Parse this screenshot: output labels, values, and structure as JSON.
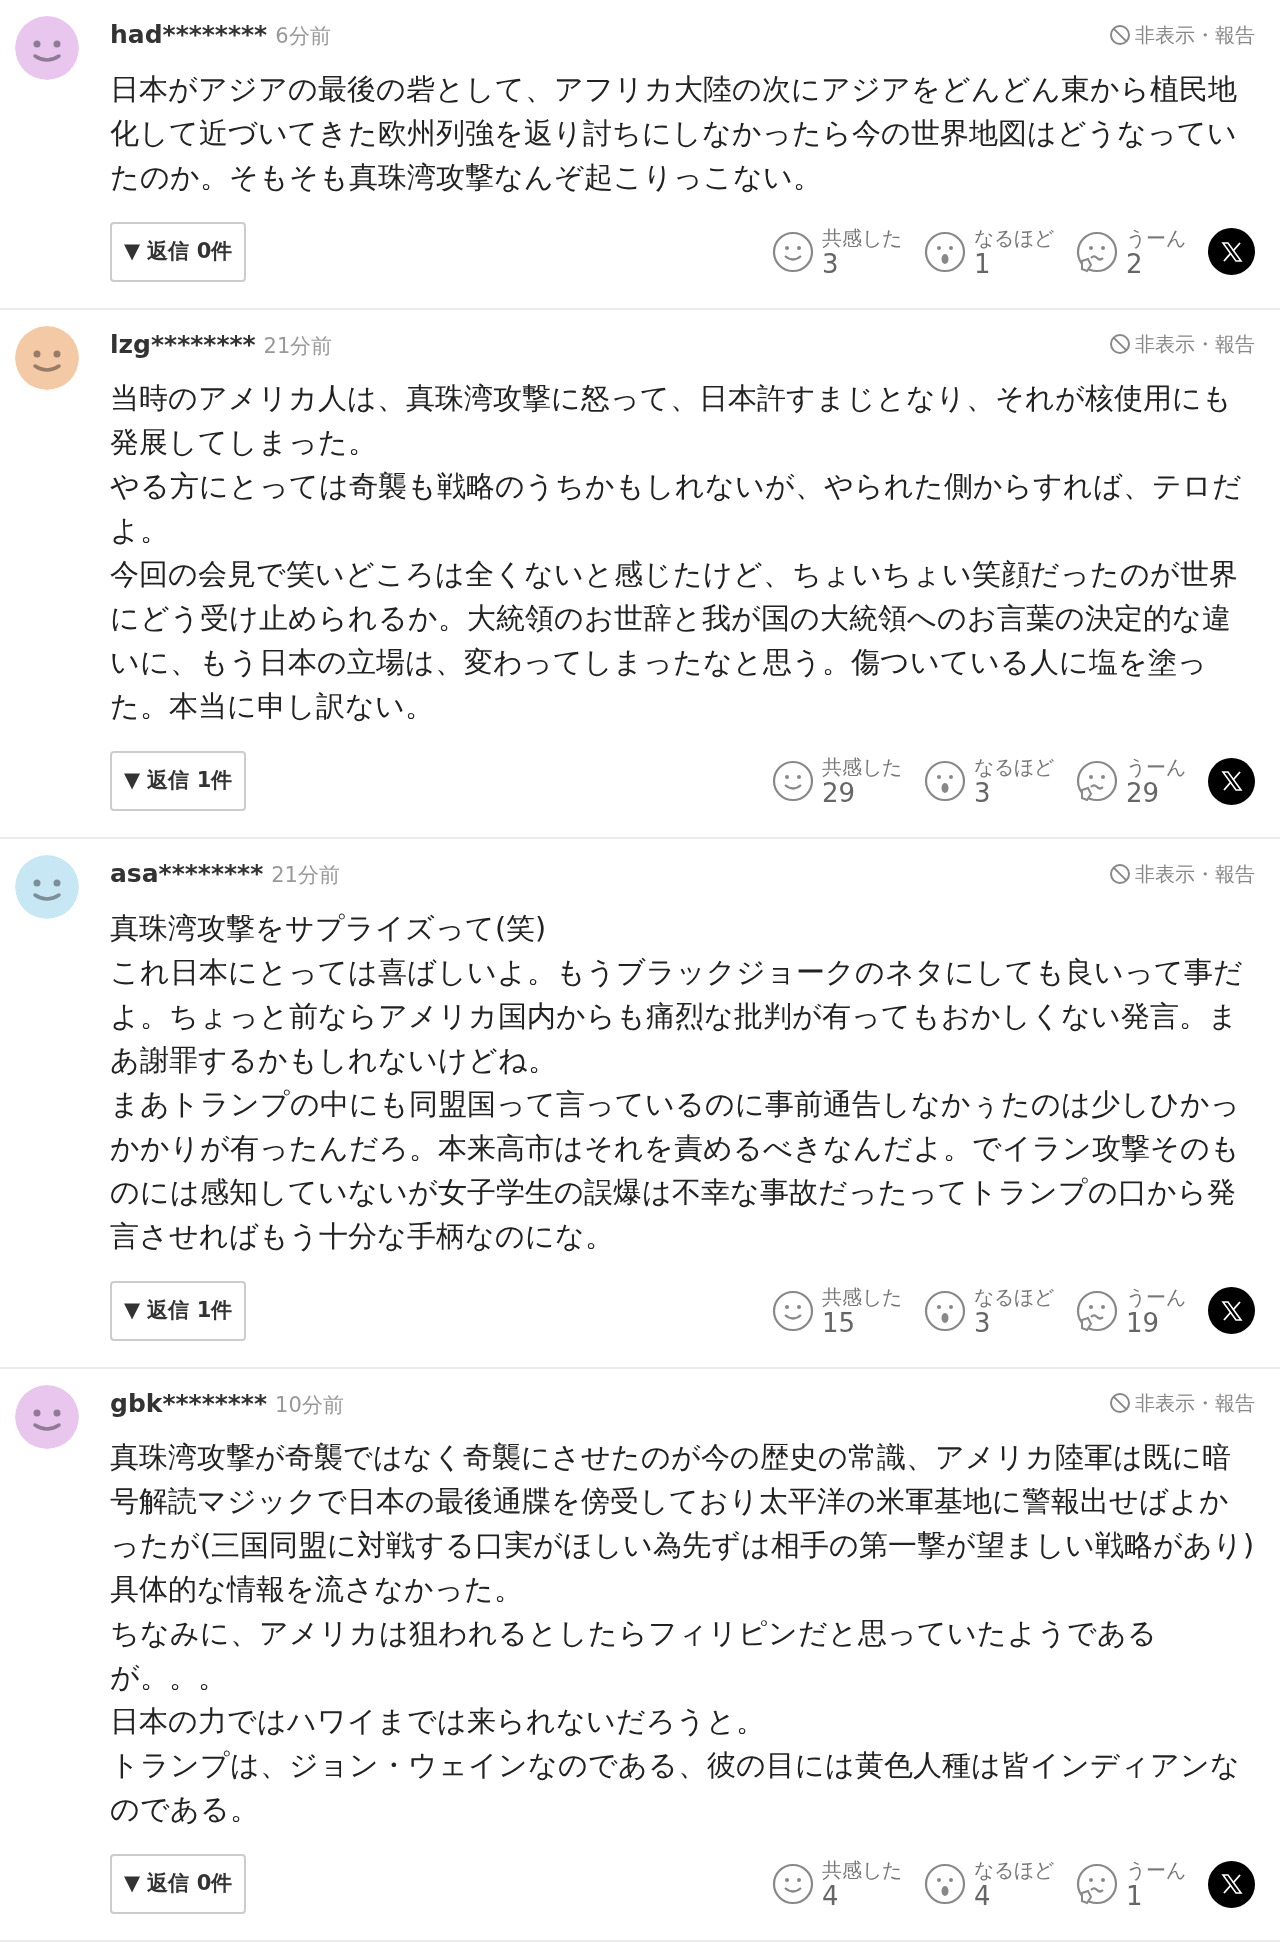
{
  "comments": [
    {
      "color": "#e8c6ee",
      "user": "had********",
      "time": "6分前",
      "hide_report": "非表示・報告",
      "body": [
        "日本がアジアの最後の砦として、アフリカ大陸の次にアジアをどんどん東から植民地化して近づいてきた欧州列強を返り討ちにしなかったら今の世界地図はどうなっていたのか。そもそも真珠湾攻撃なんぞ起こりっこない。"
      ],
      "reply_button": "▼ 返信 0件",
      "reactions": [
        {
          "kind": "smile",
          "label": "共感した",
          "count": "3"
        },
        {
          "kind": "surprised",
          "label": "なるほど",
          "count": "1"
        },
        {
          "kind": "hmm",
          "label": "うーん",
          "count": "2"
        }
      ]
    },
    {
      "color": "#f4c9a6",
      "user": "lzg********",
      "time": "21分前",
      "hide_report": "非表示・報告",
      "body": [
        "当時のアメリカ人は、真珠湾攻撃に怒って、日本許すまじとなり、それが核使用にも発展してしまった。",
        "やる方にとっては奇襲も戦略のうちかもしれないが、やられた側からすれば、テロだよ。",
        "今回の会見で笑いどころは全くないと感じたけど、ちょいちょい笑顔だったのが世界にどう受け止められるか。大統領のお世辞と我が国の大統領へのお言葉の決定的な違いに、もう日本の立場は、変わってしまったなと思う。傷ついている人に塩を塗った。本当に申し訳ない。"
      ],
      "reply_button": "▼ 返信 1件",
      "reactions": [
        {
          "kind": "smile",
          "label": "共感した",
          "count": "29"
        },
        {
          "kind": "surprised",
          "label": "なるほど",
          "count": "3"
        },
        {
          "kind": "hmm",
          "label": "うーん",
          "count": "29"
        }
      ]
    },
    {
      "color": "#c8e7f5",
      "user": "asa********",
      "time": "21分前",
      "hide_report": "非表示・報告",
      "body": [
        "真珠湾攻撃をサプライズって(笑)",
        "これ日本にとっては喜ばしいよ。もうブラックジョークのネタにしても良いって事だよ。ちょっと前ならアメリカ国内からも痛烈な批判が有ってもおかしくない発言。まあ謝罪するかもしれないけどね。",
        "まあトランプの中にも同盟国って言っているのに事前通告しなかぅたのは少しひかっかかりが有ったんだろ。本来高市はそれを責めるべきなんだよ。でイラン攻撃そのものには感知していないが女子学生の誤爆は不幸な事故だったってトランプの口から発言させればもう十分な手柄なのにな。"
      ],
      "reply_button": "▼ 返信 1件",
      "reactions": [
        {
          "kind": "smile",
          "label": "共感した",
          "count": "15"
        },
        {
          "kind": "surprised",
          "label": "なるほど",
          "count": "3"
        },
        {
          "kind": "hmm",
          "label": "うーん",
          "count": "19"
        }
      ]
    },
    {
      "color": "#e8c6ee",
      "user": "gbk********",
      "time": "10分前",
      "hide_report": "非表示・報告",
      "body": [
        "真珠湾攻撃が奇襲ではなく奇襲にさせたのが今の歴史の常識、アメリカ陸軍は既に暗号解読マジックで日本の最後通牒を傍受しており太平洋の米軍基地に警報出せばよかったが(三国同盟に対戦する口実がほしい為先ずは相手の第一撃が望ましい戦略があり)具体的な情報を流さなかった。",
        "ちなみに、アメリカは狙われるとしたらフィリピンだと思っていたようであるが。。。",
        "日本の力ではハワイまでは来られないだろうと。",
        "トランプは、ジョン・ウェインなのである、彼の目には黄色人種は皆インディアンなのである。"
      ],
      "reply_button": "▼ 返信 0件",
      "reactions": [
        {
          "kind": "smile",
          "label": "共感した",
          "count": "4"
        },
        {
          "kind": "surprised",
          "label": "なるほど",
          "count": "4"
        },
        {
          "kind": "hmm",
          "label": "うーん",
          "count": "1"
        }
      ]
    }
  ]
}
